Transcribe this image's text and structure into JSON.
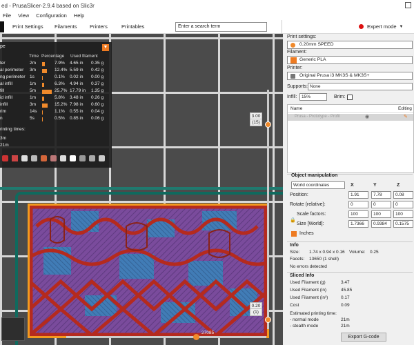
{
  "window": {
    "title": "ed - PrusaSlicer-2.9.4 based on Slic3r"
  },
  "menu": [
    "File",
    "View",
    "Configuration",
    "Help"
  ],
  "tabs": {
    "print_settings": "Print Settings",
    "filaments": "Filaments",
    "printers": "Printers",
    "printables": "Printables"
  },
  "search": {
    "placeholder": "Enter a search term"
  },
  "mode": {
    "label": "Expert mode"
  },
  "legend": {
    "type_label": "pe",
    "col_time": "Time",
    "col_percentage": "Percentage",
    "col_used": "Used filament",
    "rows": [
      {
        "name": "ter",
        "time": "2m",
        "pct": "7.9%",
        "len": "4.65 in",
        "g": "0.35 g",
        "pct_value": 7.9
      },
      {
        "name": "al perimeter",
        "time": "3m",
        "pct": "12.4%",
        "len": "5.59 in",
        "g": "0.42 g",
        "pct_value": 12.4
      },
      {
        "name": "ng perimeter",
        "time": "1s",
        "pct": "0.1%",
        "len": "0.02 in",
        "g": "0.00 g",
        "pct_value": 0.1
      },
      {
        "name": "al infill",
        "time": "1m",
        "pct": "6.3%",
        "len": "4.94 in",
        "g": "0.37 g",
        "pct_value": 6.3
      },
      {
        "name": "fill",
        "time": "5m",
        "pct": "25.7%",
        "len": "17.79 in",
        "g": "1.35 g",
        "pct_value": 25.7
      },
      {
        "name": "id infill",
        "time": "1m",
        "pct": "5.8%",
        "len": "3.48 in",
        "g": "0.26 g",
        "pct_value": 5.8
      },
      {
        "name": "infill",
        "time": "3m",
        "pct": "15.2%",
        "len": "7.98 in",
        "g": "0.60 g",
        "pct_value": 15.2
      },
      {
        "name": "rim",
        "time": "14s",
        "pct": "1.1%",
        "len": "0.55 in",
        "g": "0.04 g",
        "pct_value": 1.1
      },
      {
        "name": "n",
        "time": "5s",
        "pct": "0.5%",
        "len": "0.85 in",
        "g": "0.06 g",
        "pct_value": 0.5
      }
    ],
    "printing_times_label": "rinting times:",
    "time_a": "3m",
    "time_b": "21m"
  },
  "slider": {
    "top_value": "3.00",
    "top_layer": "(15)",
    "bottom_value": "0.20",
    "bottom_layer": "(1)",
    "h_value": "27085"
  },
  "right": {
    "print_settings_label": "Print settings:",
    "print_profile": "0.20mm SPEED",
    "filament_label": "Filament:",
    "filament_profile": "Generic PLA",
    "printer_label": "Printer:",
    "printer_profile": "Original Prusa i3 MK3S & MK3S+",
    "supports_label": "Supports:",
    "supports_value": "None",
    "infill_label": "Infill:",
    "infill_value": "15%",
    "brim_label": "Brim:",
    "table_name": "Name",
    "table_editing": "Editing",
    "table_row": "Prusa - Prototype - Profil",
    "obj_manip": "Object manipulation",
    "coords": "World coordinates",
    "x": "X",
    "y": "Y",
    "z": "Z",
    "position_label": "Position:",
    "pos": [
      "1.91",
      "7.78",
      "0.08"
    ],
    "rotate_label": "Rotate (relative):",
    "rot": [
      "0",
      "0",
      "0"
    ],
    "scale_label": "Scale factors:",
    "scale": [
      "100",
      "100",
      "100"
    ],
    "size_label": "Size [World]:",
    "size": [
      "1.7366",
      "0.9384",
      "0.1575"
    ],
    "inches_label": "Inches",
    "info_title": "Info",
    "size_info_label": "Size:",
    "size_info": "1.74 x 0.94 x 0.16",
    "volume_label": "Volume:",
    "volume": "0.25",
    "facets_label": "Facets:",
    "facets": "13650 (1 shell)",
    "errors": "No errors detected",
    "sliced_title": "Sliced Info",
    "used_g_label": "Used Filament (g)",
    "used_g": "3.47",
    "used_in_label": "Used Filament (in)",
    "used_in": "45.85",
    "used_in3_label": "Used Filament (in³)",
    "used_in3": "0.17",
    "cost_label": "Cost",
    "cost": "0.09",
    "est_label": "Estimated printing time:",
    "normal_label": "- normal mode",
    "normal": "21m",
    "stealth_label": "- stealth mode",
    "stealth": "21m",
    "export_label": "Export G-code"
  },
  "colors": {
    "accent": "#ee7b22",
    "part": "#7a4b9c",
    "perimeter": "#b52a1e",
    "infill_blue": "#3f7fb8",
    "bed_outline": "#0f6a5e"
  }
}
